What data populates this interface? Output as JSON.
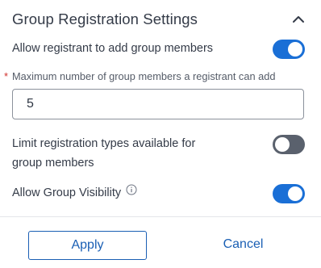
{
  "panel": {
    "title": "Group Registration Settings",
    "collapse_icon": "chevron-up-icon"
  },
  "settings": {
    "allow_add_members": {
      "label": "Allow registrant to add group members",
      "enabled": true
    },
    "max_members": {
      "required_mark": "*",
      "label": "Maximum number of group members a registrant can add",
      "value": "5"
    },
    "limit_registration_types": {
      "label_line1": "Limit registration types available for",
      "label_line2": "group members",
      "enabled": false
    },
    "group_visibility": {
      "label": "Allow Group Visibility",
      "info_icon": "info-icon",
      "enabled": true
    }
  },
  "footer": {
    "apply_label": "Apply",
    "cancel_label": "Cancel"
  },
  "colors": {
    "accent": "#1a6fd6",
    "link": "#1a5fb4",
    "toggle_off": "#5a616d",
    "required": "#d0312d"
  }
}
